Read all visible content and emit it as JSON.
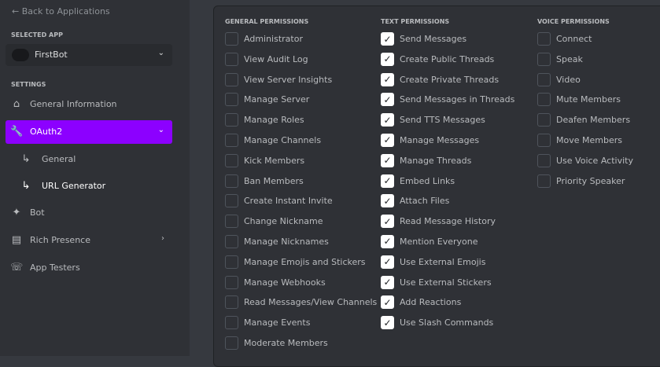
{
  "sidebar": {
    "back": "← Back to Applications",
    "selected_app_heading": "SELECTED APP",
    "app_name": "FirstBot",
    "settings_heading": "SETTINGS",
    "items": [
      {
        "label": "General Information",
        "icon": "home-icon"
      },
      {
        "label": "OAuth2",
        "icon": "wrench-icon"
      },
      {
        "label": "General",
        "icon": "sub-arrow-icon"
      },
      {
        "label": "URL Generator",
        "icon": "sub-arrow-icon"
      },
      {
        "label": "Bot",
        "icon": "puzzle-icon"
      },
      {
        "label": "Rich Presence",
        "icon": "document-icon"
      },
      {
        "label": "App Testers",
        "icon": "phone-user-icon"
      }
    ]
  },
  "accent": "#8c00ff",
  "permissions": [
    {
      "heading": "GENERAL PERMISSIONS",
      "items": [
        {
          "label": "Administrator",
          "checked": false
        },
        {
          "label": "View Audit Log",
          "checked": false
        },
        {
          "label": "View Server Insights",
          "checked": false
        },
        {
          "label": "Manage Server",
          "checked": false
        },
        {
          "label": "Manage Roles",
          "checked": false
        },
        {
          "label": "Manage Channels",
          "checked": false
        },
        {
          "label": "Kick Members",
          "checked": false
        },
        {
          "label": "Ban Members",
          "checked": false
        },
        {
          "label": "Create Instant Invite",
          "checked": false
        },
        {
          "label": "Change Nickname",
          "checked": false
        },
        {
          "label": "Manage Nicknames",
          "checked": false
        },
        {
          "label": "Manage Emojis and Stickers",
          "checked": false
        },
        {
          "label": "Manage Webhooks",
          "checked": false
        },
        {
          "label": "Read Messages/View Channels",
          "checked": false
        },
        {
          "label": "Manage Events",
          "checked": false
        },
        {
          "label": "Moderate Members",
          "checked": false
        }
      ]
    },
    {
      "heading": "TEXT PERMISSIONS",
      "items": [
        {
          "label": "Send Messages",
          "checked": true
        },
        {
          "label": "Create Public Threads",
          "checked": true
        },
        {
          "label": "Create Private Threads",
          "checked": true
        },
        {
          "label": "Send Messages in Threads",
          "checked": true
        },
        {
          "label": "Send TTS Messages",
          "checked": true
        },
        {
          "label": "Manage Messages",
          "checked": true
        },
        {
          "label": "Manage Threads",
          "checked": true
        },
        {
          "label": "Embed Links",
          "checked": true
        },
        {
          "label": "Attach Files",
          "checked": true
        },
        {
          "label": "Read Message History",
          "checked": true
        },
        {
          "label": "Mention Everyone",
          "checked": true
        },
        {
          "label": "Use External Emojis",
          "checked": true
        },
        {
          "label": "Use External Stickers",
          "checked": true
        },
        {
          "label": "Add Reactions",
          "checked": true
        },
        {
          "label": "Use Slash Commands",
          "checked": true
        }
      ]
    },
    {
      "heading": "VOICE PERMISSIONS",
      "items": [
        {
          "label": "Connect",
          "checked": false
        },
        {
          "label": "Speak",
          "checked": false
        },
        {
          "label": "Video",
          "checked": false
        },
        {
          "label": "Mute Members",
          "checked": false
        },
        {
          "label": "Deafen Members",
          "checked": false
        },
        {
          "label": "Move Members",
          "checked": false
        },
        {
          "label": "Use Voice Activity",
          "checked": false
        },
        {
          "label": "Priority Speaker",
          "checked": false
        }
      ]
    }
  ]
}
